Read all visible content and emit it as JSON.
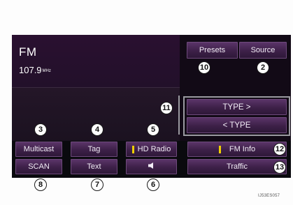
{
  "radio": {
    "band": "FM",
    "frequency": "107.9",
    "frequency_unit": "MHz"
  },
  "buttons": {
    "presets": "Presets",
    "source": "Source",
    "type_next": "TYPE >",
    "type_prev": "< TYPE",
    "multicast": "Multicast",
    "tag": "Tag",
    "hd_radio": "HD Radio",
    "fm_info": "FM Info",
    "scan": "SCAN",
    "text": "Text",
    "traffic": "Traffic"
  },
  "icons": {
    "audio": "speaker-icon",
    "hd_radio_indicator": "indicator-bar-icon",
    "fm_info_indicator": "indicator-bar-icon"
  },
  "callouts": {
    "c2": "2",
    "c3": "3",
    "c4": "4",
    "c5": "5",
    "c6": "6",
    "c7": "7",
    "c8": "8",
    "c10": "10",
    "c11": "11",
    "c12": "12",
    "c13": "13"
  },
  "figure_code": "IJ53ES057",
  "colors": {
    "indicator": "#f0d000",
    "button_top": "#5a3468",
    "button_bottom": "#2e1838"
  }
}
